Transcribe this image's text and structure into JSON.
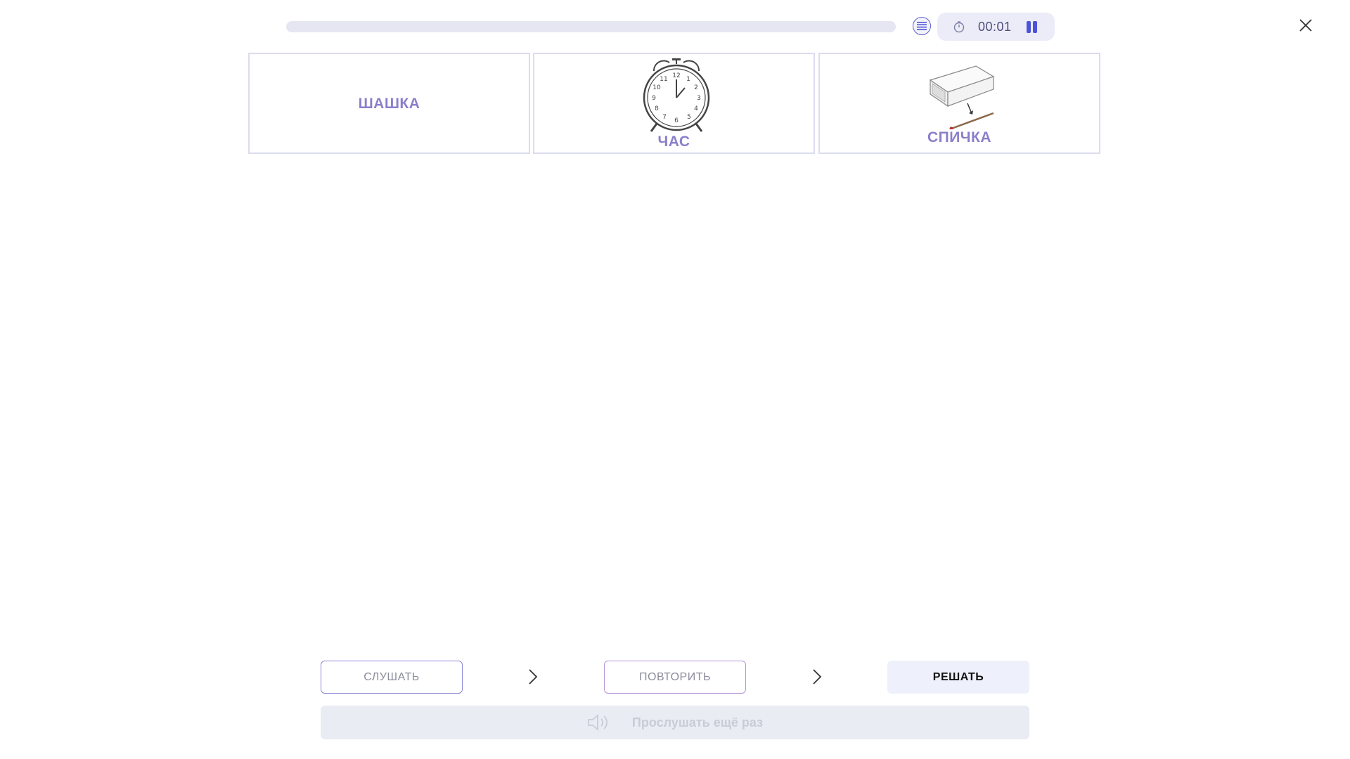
{
  "header": {
    "progress": 0,
    "timer": "00:01",
    "list_icon": "list-icon",
    "timer_icon": "stopwatch-icon",
    "pause_icon": "pause-icon",
    "close_icon": "close-icon"
  },
  "cards": [
    {
      "label": "ШАШКА",
      "image": null
    },
    {
      "label": "ЧАС",
      "image": "alarm-clock-icon"
    },
    {
      "label": "СПИЧКА",
      "image": "matchbox-icon"
    }
  ],
  "controls": {
    "listen_label": "СЛУШАТЬ",
    "repeat_label": "ПОВТОРИТЬ",
    "solve_label": "РЕШАТЬ",
    "listen_again_label": "Прослушать ещё раз"
  },
  "colors": {
    "accent": "#4b54d6",
    "card_label": "#8a7fcb",
    "progress_track": "#e6e5f2"
  }
}
